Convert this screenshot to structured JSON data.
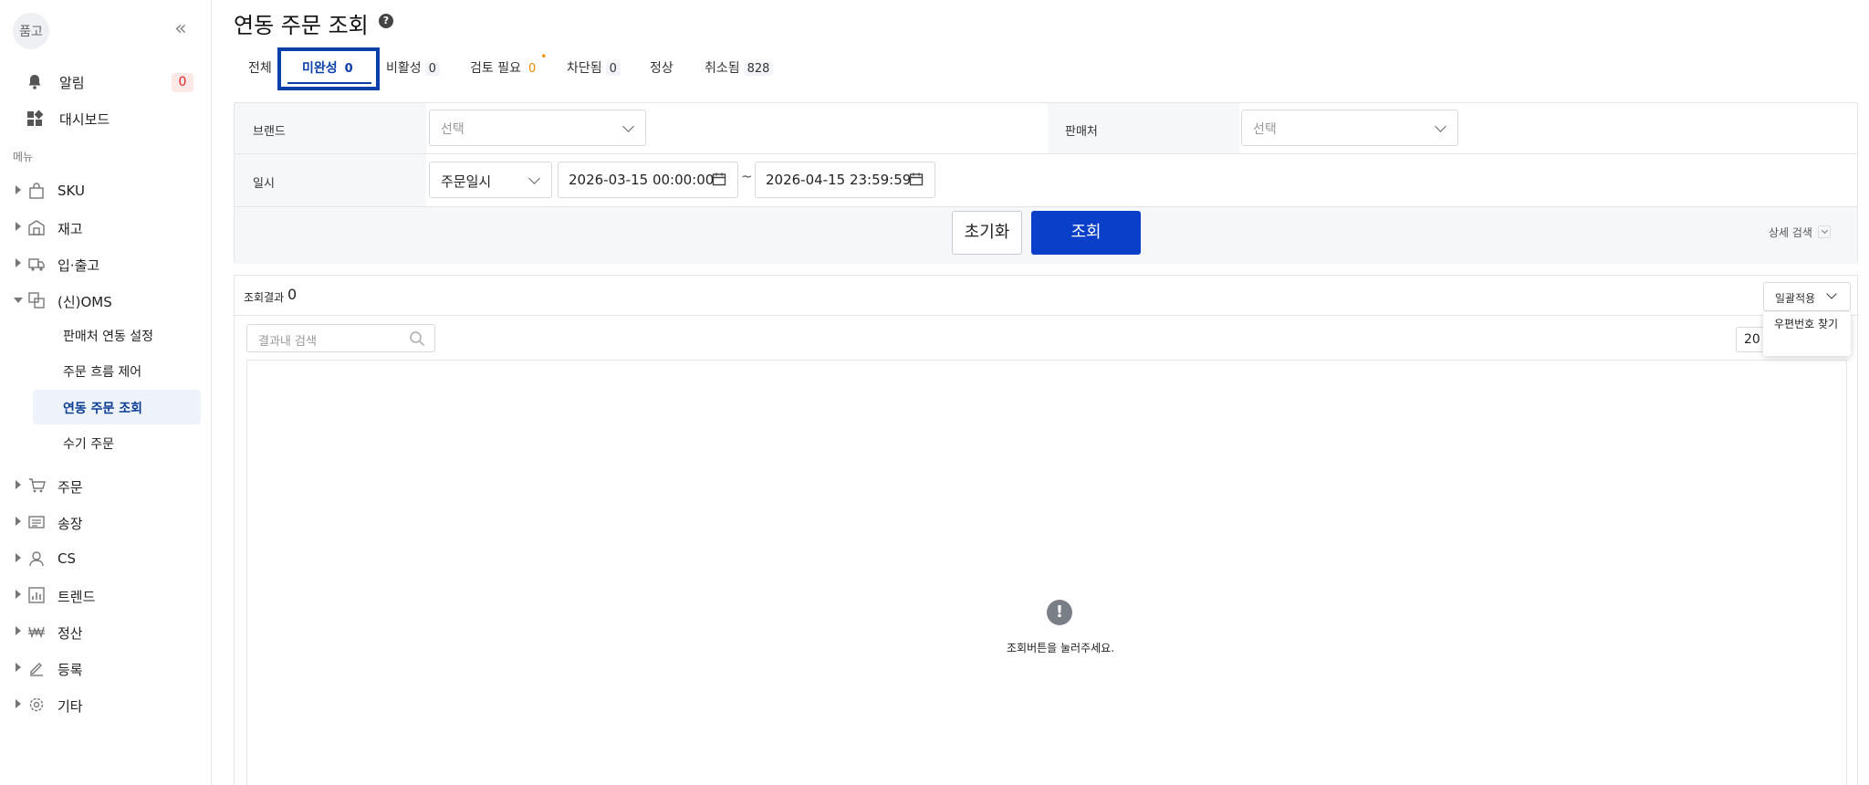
{
  "sidebar": {
    "brand": "품고",
    "top_items": [
      {
        "label": "알림",
        "icon": "bell-icon",
        "badge": "0"
      },
      {
        "label": "대시보드",
        "icon": "dashboard-icon"
      }
    ],
    "menu_caption": "메뉴",
    "groups": [
      {
        "label": "SKU",
        "icon": "bag-icon"
      },
      {
        "label": "재고",
        "icon": "warehouse-icon"
      },
      {
        "label": "입·출고",
        "icon": "truck-icon"
      },
      {
        "label": "(신)OMS",
        "icon": "link-icon",
        "expanded": true,
        "children": [
          "판매처 연동 설정",
          "주문 흐름 제어",
          "연동 주문 조회",
          "수기 주문"
        ],
        "active_child": "연동 주문 조회"
      },
      {
        "label": "주문",
        "icon": "cart-icon"
      },
      {
        "label": "송장",
        "icon": "invoice-icon"
      },
      {
        "label": "CS",
        "icon": "person-icon"
      },
      {
        "label": "트렌드",
        "icon": "chart-icon"
      },
      {
        "label": "정산",
        "icon": "won-icon"
      },
      {
        "label": "등록",
        "icon": "pencil-icon"
      },
      {
        "label": "기타",
        "icon": "settings-icon"
      }
    ]
  },
  "page": {
    "title": "연동 주문 조회"
  },
  "tabs": [
    {
      "label": "전체",
      "count": ""
    },
    {
      "label": "미완성",
      "count": "0",
      "active": true
    },
    {
      "label": "비활성",
      "count": "0"
    },
    {
      "label": "검토 필요",
      "count": "0",
      "warn": true,
      "dot": "•"
    },
    {
      "label": "차단됨",
      "count": "0"
    },
    {
      "label": "정상",
      "count": ""
    },
    {
      "label": "취소됨",
      "count": "828"
    }
  ],
  "filters": {
    "brand_label": "브랜드",
    "brand_placeholder": "선택",
    "seller_label": "판매처",
    "seller_placeholder": "선택",
    "date_label": "일시",
    "date_type": "주문일시",
    "date_from": "2026-03-15 00:00:00",
    "date_to": "2026-04-15 23:59:59",
    "tilde": "~",
    "reset_button": "초기화",
    "search_button": "조회",
    "advanced": "상세 검색"
  },
  "results": {
    "label": "조회결과",
    "count": "0",
    "bulk_button": "일괄적용",
    "dropdown_item": "우편번호 찾기",
    "search_placeholder": "결과내 검색",
    "page_size": "20",
    "empty_icon": "!",
    "empty_message": "조회버튼을 눌러주세요."
  },
  "colors": {
    "primary": "#0a3fc9",
    "active_tab_box": "#0a3fa9",
    "alert": "#e0252a",
    "warn": "#f08b00"
  }
}
